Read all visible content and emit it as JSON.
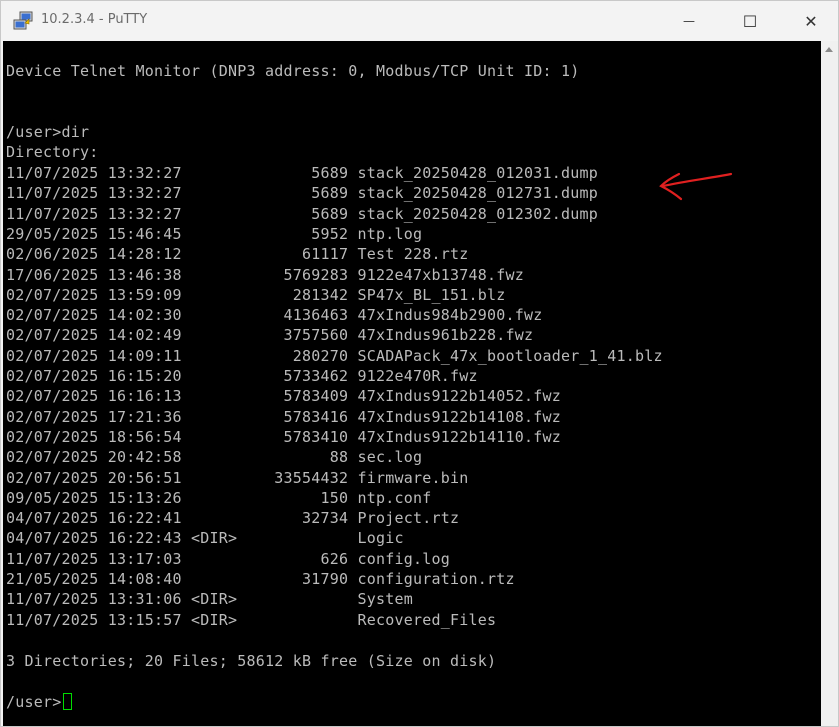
{
  "window": {
    "title": "10.2.3.4 - PuTTY",
    "accent_color": "#22c55e",
    "controls": {
      "minimize": "—",
      "maximize": "☐",
      "close": "✕"
    }
  },
  "terminal": {
    "banner": "Device Telnet Monitor (DNP3 address: 0, Modbus/TCP Unit ID: 1)",
    "command_prompt": "/user>dir",
    "directory_label": "Directory:",
    "entries": [
      {
        "date": "11/07/2025",
        "time": "13:32:27",
        "type": "",
        "size": "5689",
        "name": "stack_20250428_012031.dump"
      },
      {
        "date": "11/07/2025",
        "time": "13:32:27",
        "type": "",
        "size": "5689",
        "name": "stack_20250428_012731.dump"
      },
      {
        "date": "11/07/2025",
        "time": "13:32:27",
        "type": "",
        "size": "5689",
        "name": "stack_20250428_012302.dump"
      },
      {
        "date": "29/05/2025",
        "time": "15:46:45",
        "type": "",
        "size": "5952",
        "name": "ntp.log"
      },
      {
        "date": "02/06/2025",
        "time": "14:28:12",
        "type": "",
        "size": "61117",
        "name": "Test 228.rtz"
      },
      {
        "date": "17/06/2025",
        "time": "13:46:38",
        "type": "",
        "size": "5769283",
        "name": "9122e47xb13748.fwz"
      },
      {
        "date": "02/07/2025",
        "time": "13:59:09",
        "type": "",
        "size": "281342",
        "name": "SP47x_BL_151.blz"
      },
      {
        "date": "02/07/2025",
        "time": "14:02:30",
        "type": "",
        "size": "4136463",
        "name": "47xIndus984b2900.fwz"
      },
      {
        "date": "02/07/2025",
        "time": "14:02:49",
        "type": "",
        "size": "3757560",
        "name": "47xIndus961b228.fwz"
      },
      {
        "date": "02/07/2025",
        "time": "14:09:11",
        "type": "",
        "size": "280270",
        "name": "SCADAPack_47x_bootloader_1_41.blz"
      },
      {
        "date": "02/07/2025",
        "time": "16:15:20",
        "type": "",
        "size": "5733462",
        "name": "9122e470R.fwz"
      },
      {
        "date": "02/07/2025",
        "time": "16:16:13",
        "type": "",
        "size": "5783409",
        "name": "47xIndus9122b14052.fwz"
      },
      {
        "date": "02/07/2025",
        "time": "17:21:36",
        "type": "",
        "size": "5783416",
        "name": "47xIndus9122b14108.fwz"
      },
      {
        "date": "02/07/2025",
        "time": "18:56:54",
        "type": "",
        "size": "5783410",
        "name": "47xIndus9122b14110.fwz"
      },
      {
        "date": "02/07/2025",
        "time": "20:42:58",
        "type": "",
        "size": "88",
        "name": "sec.log"
      },
      {
        "date": "02/07/2025",
        "time": "20:56:51",
        "type": "",
        "size": "33554432",
        "name": "firmware.bin"
      },
      {
        "date": "09/05/2025",
        "time": "15:13:26",
        "type": "",
        "size": "150",
        "name": "ntp.conf"
      },
      {
        "date": "04/07/2025",
        "time": "16:22:41",
        "type": "",
        "size": "32734",
        "name": "Project.rtz"
      },
      {
        "date": "04/07/2025",
        "time": "16:22:43",
        "type": "<DIR>",
        "size": "",
        "name": "Logic"
      },
      {
        "date": "11/07/2025",
        "time": "13:17:03",
        "type": "",
        "size": "626",
        "name": "config.log"
      },
      {
        "date": "21/05/2025",
        "time": "14:08:40",
        "type": "",
        "size": "31790",
        "name": "configuration.rtz"
      },
      {
        "date": "11/07/2025",
        "time": "13:31:06",
        "type": "<DIR>",
        "size": "",
        "name": "System"
      },
      {
        "date": "11/07/2025",
        "time": "13:15:57",
        "type": "<DIR>",
        "size": "",
        "name": "Recovered_Files"
      }
    ],
    "summary": "3 Directories; 20 Files; 58612 kB free (Size on disk)",
    "final_prompt": "/user>",
    "text_color": "#bbbbbb",
    "background_color": "#000000",
    "cursor_color": "#00dd00"
  },
  "annotation": {
    "icon": "red-hand-drawn-arrow-icon",
    "color": "#e02020"
  }
}
